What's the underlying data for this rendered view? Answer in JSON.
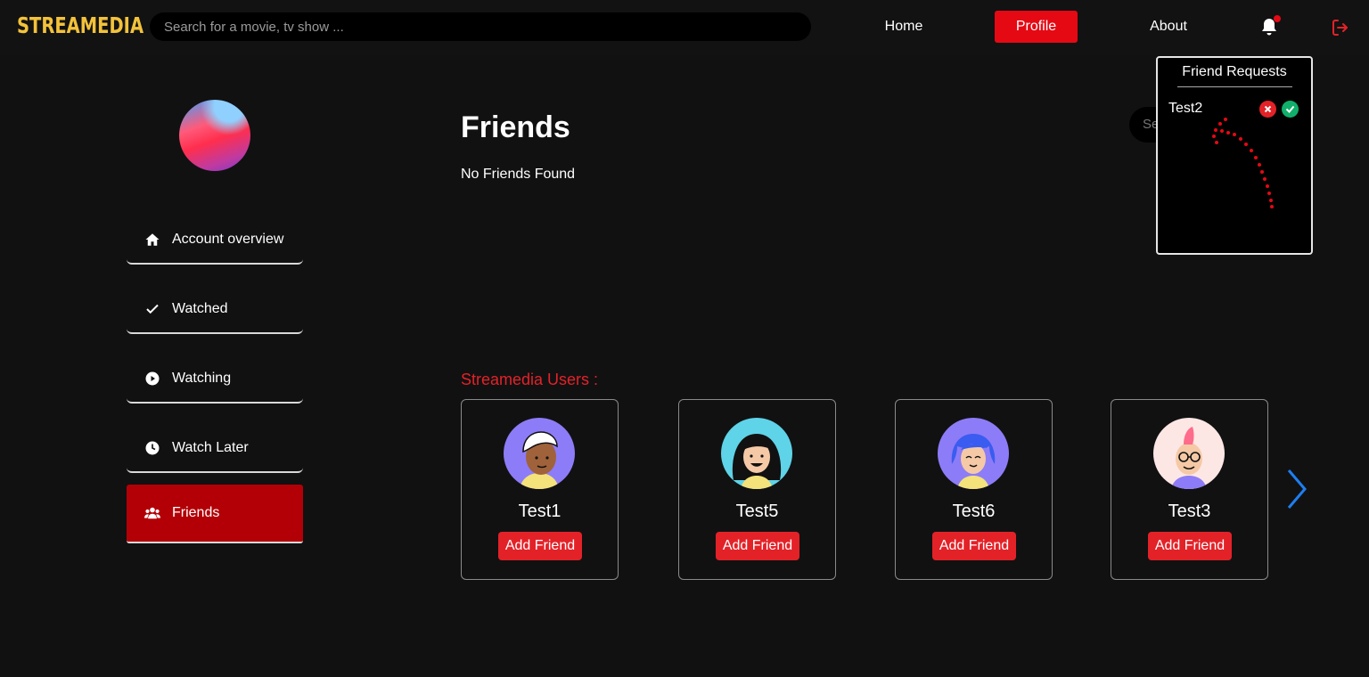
{
  "header": {
    "logo": "STREAMEDIA",
    "search_placeholder": "Search for a movie, tv show ...",
    "nav": {
      "home": "Home",
      "profile": "Profile",
      "about": "About"
    },
    "accent_color": "#e50914"
  },
  "sidebar": {
    "items": [
      {
        "label": "Account overview",
        "icon": "home-icon"
      },
      {
        "label": "Watched",
        "icon": "check-icon"
      },
      {
        "label": "Watching",
        "icon": "play-circle-icon"
      },
      {
        "label": "Watch Later",
        "icon": "clock-icon"
      },
      {
        "label": "Friends",
        "icon": "users-icon",
        "active": true
      }
    ]
  },
  "main": {
    "title": "Friends",
    "empty_message": "No Friends Found",
    "search_stub": "Se",
    "users_label": "Streamedia Users :",
    "users": [
      {
        "name": "Test1",
        "button": "Add Friend",
        "avatar": "avatar-purple-bg-white-cap"
      },
      {
        "name": "Test5",
        "button": "Add Friend",
        "avatar": "avatar-cyan-bg-long-hair"
      },
      {
        "name": "Test6",
        "button": "Add Friend",
        "avatar": "avatar-purple-bg-blue-hair"
      },
      {
        "name": "Test3",
        "button": "Add Friend",
        "avatar": "avatar-pink-bg-mohawk-glasses"
      }
    ]
  },
  "friend_requests": {
    "title": "Friend Requests",
    "requests": [
      {
        "name": "Test2"
      }
    ]
  }
}
